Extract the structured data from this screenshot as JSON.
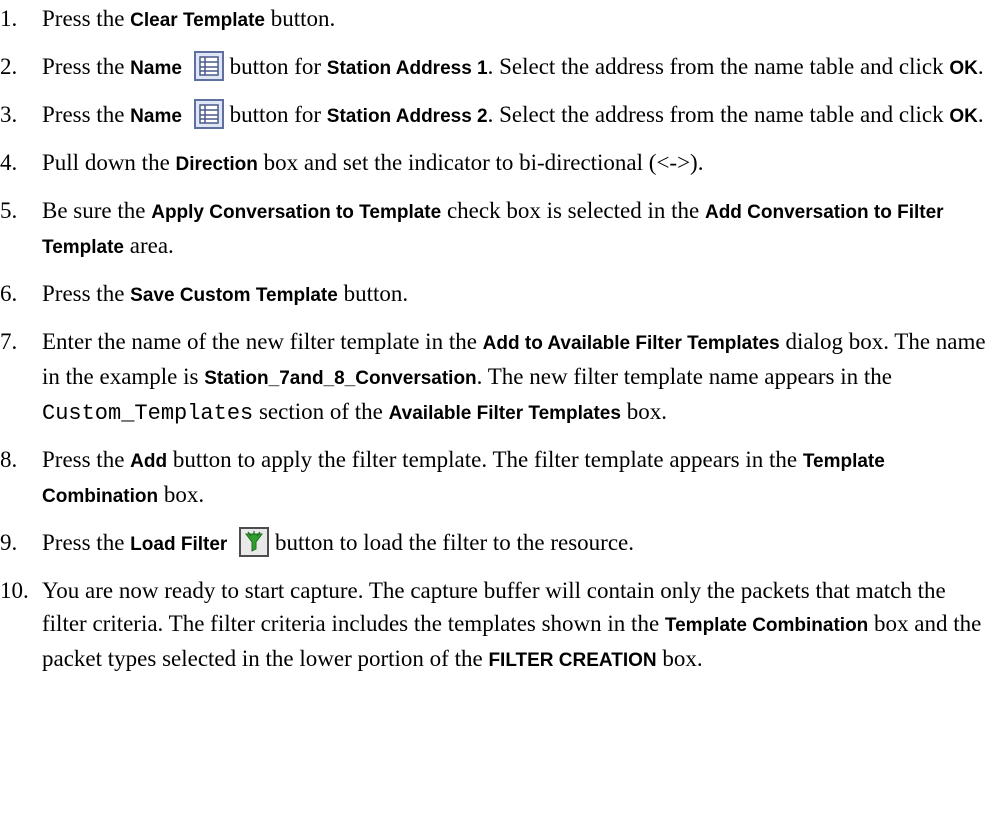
{
  "steps": [
    {
      "num": "1.",
      "parts": [
        "Press the ",
        "Clear Template",
        " button."
      ]
    },
    {
      "num": "2.",
      "parts": [
        "Press the ",
        "Name",
        "button for ",
        "Station Address 1",
        ". Select the address from the name table and click ",
        "OK",
        "."
      ],
      "icon": "name-table-icon"
    },
    {
      "num": "3.",
      "parts": [
        "Press the ",
        "Name",
        "button for ",
        "Station Address 2",
        ". Select the address from the name table and click ",
        "OK",
        "."
      ],
      "icon": "name-table-icon"
    },
    {
      "num": "4.",
      "parts": [
        "Pull down the ",
        "Direction",
        " box and set the indicator to bi-directional (<->)."
      ]
    },
    {
      "num": "5.",
      "parts": [
        "Be sure the ",
        "Apply Conversation to Template",
        " check box is selected in the ",
        "Add Conversation to Filter Template",
        " area."
      ]
    },
    {
      "num": "6.",
      "parts": [
        "Press the ",
        "Save Custom Template",
        " button."
      ]
    },
    {
      "num": "7.",
      "parts": [
        "Enter the name of the new filter template in the ",
        "Add to Available Filter Templates",
        " dialog box. The name in the example is ",
        "Station_7and_8_Conversation",
        ". The new filter template name appears in the ",
        "Custom_Templates",
        " section of the ",
        "Available Filter Templates",
        " box."
      ]
    },
    {
      "num": "8.",
      "parts": [
        "Press the ",
        "Add",
        " button to apply the filter template. The filter template appears in the ",
        "Template Combination",
        " box."
      ]
    },
    {
      "num": "9.",
      "parts": [
        "Press the ",
        "Load Filter",
        "button to load the filter to the resource."
      ],
      "icon": "load-filter-funnel-icon"
    },
    {
      "num": "10.",
      "parts": [
        "You are now ready to start capture. The capture buffer will contain only the packets that match the filter criteria. The filter criteria includes the templates shown in the ",
        "Template Combination",
        " box and the packet types selected in the lower portion of the ",
        "FILTER CREATION",
        " box."
      ]
    }
  ],
  "icons": {
    "name_table": {
      "name": "name-table-icon",
      "frame": "#5f6f9f",
      "fill": "#dfe6f5",
      "lines": "#4a5a8a"
    },
    "load_filter": {
      "name": "load-filter-funnel-icon",
      "frame": "#4d4d4d",
      "fill": "#e9e9e9",
      "funnel": "#2fa02f"
    }
  }
}
